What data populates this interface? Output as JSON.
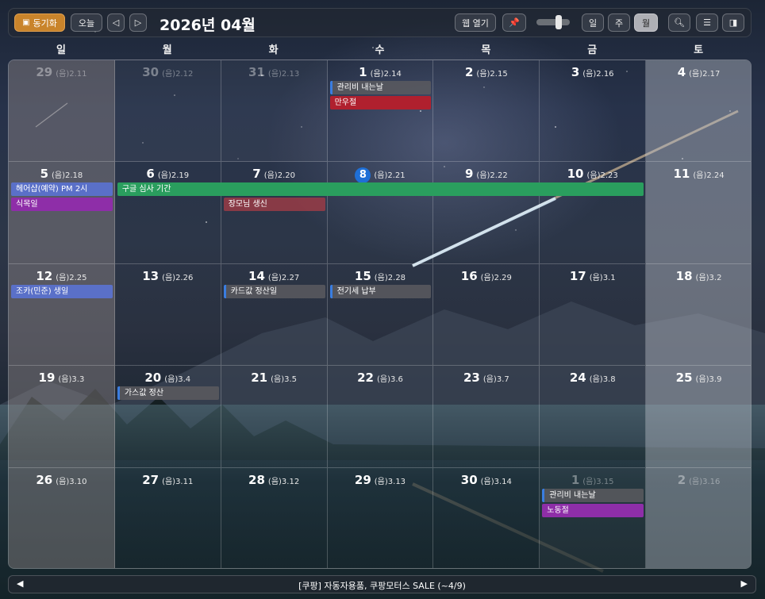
{
  "toolbar": {
    "sync_label": "동기화",
    "today_label": "오늘",
    "prev_icon": "◁",
    "next_icon": "▷",
    "title": "2026년 04월",
    "web_open_label": "웹 열기",
    "view_day": "일",
    "view_week": "주",
    "view_month": "월",
    "active_view": "월"
  },
  "weekdays": [
    "일",
    "월",
    "화",
    "수",
    "목",
    "금",
    "토"
  ],
  "weeks": [
    [
      {
        "day": "29",
        "lunar": "(음)2.11",
        "other": true
      },
      {
        "day": "30",
        "lunar": "(음)2.12",
        "other": true
      },
      {
        "day": "31",
        "lunar": "(음)2.13",
        "other": true
      },
      {
        "day": "1",
        "lunar": "(음)2.14"
      },
      {
        "day": "2",
        "lunar": "(음)2.15"
      },
      {
        "day": "3",
        "lunar": "(음)2.16"
      },
      {
        "day": "4",
        "lunar": "(음)2.17"
      }
    ],
    [
      {
        "day": "5",
        "lunar": "(음)2.18"
      },
      {
        "day": "6",
        "lunar": "(음)2.19"
      },
      {
        "day": "7",
        "lunar": "(음)2.20"
      },
      {
        "day": "8",
        "lunar": "(음)2.21",
        "today": true
      },
      {
        "day": "9",
        "lunar": "(음)2.22"
      },
      {
        "day": "10",
        "lunar": "(음)2.23"
      },
      {
        "day": "11",
        "lunar": "(음)2.24"
      }
    ],
    [
      {
        "day": "12",
        "lunar": "(음)2.25"
      },
      {
        "day": "13",
        "lunar": "(음)2.26"
      },
      {
        "day": "14",
        "lunar": "(음)2.27"
      },
      {
        "day": "15",
        "lunar": "(음)2.28"
      },
      {
        "day": "16",
        "lunar": "(음)2.29"
      },
      {
        "day": "17",
        "lunar": "(음)3.1"
      },
      {
        "day": "18",
        "lunar": "(음)3.2"
      }
    ],
    [
      {
        "day": "19",
        "lunar": "(음)3.3"
      },
      {
        "day": "20",
        "lunar": "(음)3.4"
      },
      {
        "day": "21",
        "lunar": "(음)3.5"
      },
      {
        "day": "22",
        "lunar": "(음)3.6"
      },
      {
        "day": "23",
        "lunar": "(음)3.7"
      },
      {
        "day": "24",
        "lunar": "(음)3.8"
      },
      {
        "day": "25",
        "lunar": "(음)3.9"
      }
    ],
    [
      {
        "day": "26",
        "lunar": "(음)3.10"
      },
      {
        "day": "27",
        "lunar": "(음)3.11"
      },
      {
        "day": "28",
        "lunar": "(음)3.12"
      },
      {
        "day": "29",
        "lunar": "(음)3.13"
      },
      {
        "day": "30",
        "lunar": "(음)3.14"
      },
      {
        "day": "1",
        "lunar": "(음)3.15",
        "other": true
      },
      {
        "day": "2",
        "lunar": "(음)3.16",
        "other": true
      }
    ]
  ],
  "events": [
    {
      "week": 0,
      "col": 3,
      "span": 1,
      "row": 0,
      "title": "관리비 내는날",
      "style": "gray"
    },
    {
      "week": 0,
      "col": 3,
      "span": 1,
      "row": 1,
      "title": "만우절",
      "style": "red"
    },
    {
      "week": 1,
      "col": 0,
      "span": 1,
      "row": 0,
      "title": "헤어샵(예약) PM 2시",
      "style": "blue"
    },
    {
      "week": 1,
      "col": 1,
      "span": 5,
      "row": 0,
      "title": "구글 심사 기간",
      "style": "green"
    },
    {
      "week": 1,
      "col": 0,
      "span": 1,
      "row": 1,
      "title": "식목일",
      "style": "purple"
    },
    {
      "week": 1,
      "col": 2,
      "span": 1,
      "row": 1,
      "title": "장모님 생신",
      "style": "pink"
    },
    {
      "week": 2,
      "col": 0,
      "span": 1,
      "row": 0,
      "title": "조카(민준) 생일",
      "style": "blue"
    },
    {
      "week": 2,
      "col": 2,
      "span": 1,
      "row": 0,
      "title": "카드값 정산일",
      "style": "gray"
    },
    {
      "week": 2,
      "col": 3,
      "span": 1,
      "row": 0,
      "title": "전기세 납부",
      "style": "gray"
    },
    {
      "week": 3,
      "col": 1,
      "span": 1,
      "row": 0,
      "title": "가스값 정산",
      "style": "gray"
    },
    {
      "week": 4,
      "col": 5,
      "span": 1,
      "row": 0,
      "title": "관리비 내는날",
      "style": "gray"
    },
    {
      "week": 4,
      "col": 5,
      "span": 1,
      "row": 1,
      "title": "노동절",
      "style": "purple"
    }
  ],
  "footer": {
    "prev_icon": "◀",
    "next_icon": "▶",
    "text": "[쿠팡] 자동자용품, 쿠팡모터스 SALE (~4/9)"
  }
}
